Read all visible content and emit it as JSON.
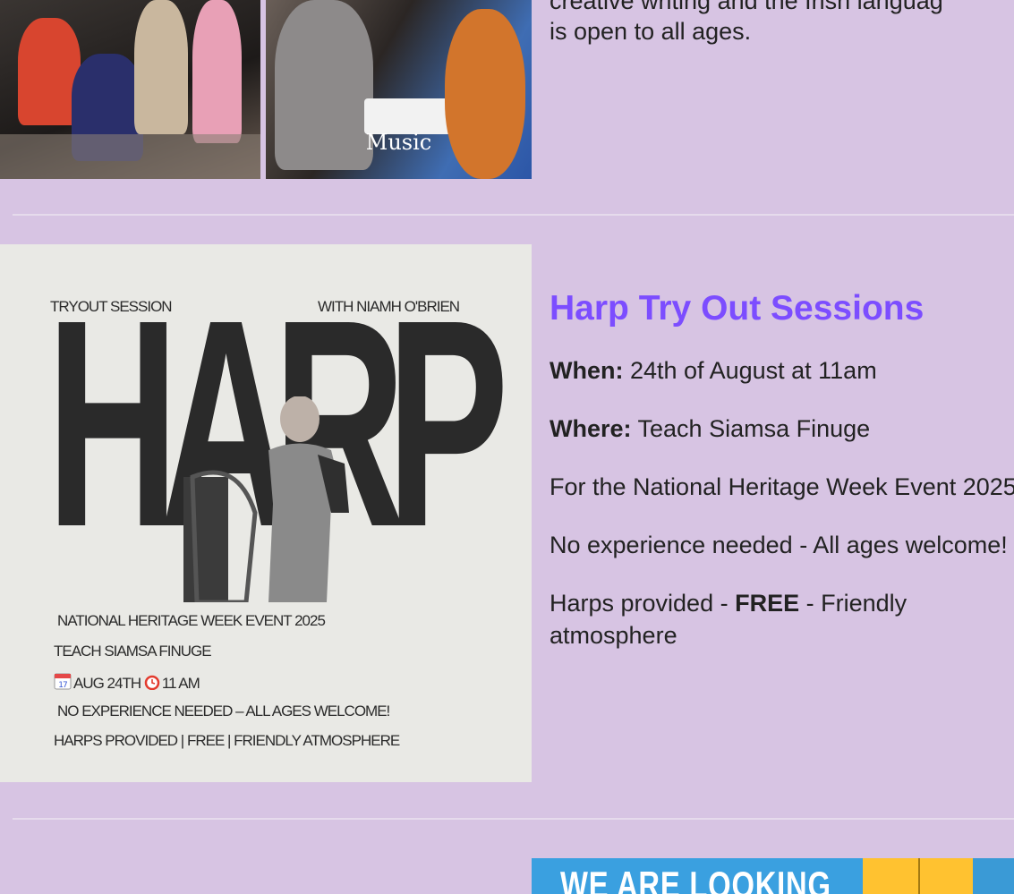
{
  "top": {
    "photo_right_caption": "Music",
    "intro_line1": "creative writing and the Irish languag",
    "intro_line2": "is open to all ages."
  },
  "poster": {
    "tryout": "TRYOUT SESSION",
    "with": "WITH NIAMH O'BRIEN",
    "big_word": "HARP",
    "line_event": "NATIONAL HERITAGE WEEK EVENT 2025",
    "line_venue": "TEACH SIAMSA FINUGE",
    "line_date": "AUG 24TH",
    "line_time": "11 AM",
    "line_experience": "NO EXPERIENCE NEEDED – ALL AGES WELCOME!",
    "line_harps": "HARPS PROVIDED | FREE | FRIENDLY ATMOSPHERE",
    "calendar_day": "17"
  },
  "harp_info": {
    "title": "Harp Try Out Sessions",
    "when_label": "When:",
    "when_value": " 24th of August at 11am",
    "where_label": "Where:",
    "where_value": " Teach Siamsa Finuge",
    "national": "For the National Heritage Week Event 2025",
    "experience": "No experience needed - All ages welcome!",
    "harps_pre": "Harps provided - ",
    "harps_free": "FREE",
    "harps_post": " - Friendly atmosphere"
  },
  "banner": {
    "title": "WE ARE LOOKING"
  },
  "colors": {
    "background": "#d7c4e3",
    "heading": "#7c4dff",
    "poster_bg": "#e9e9e5"
  }
}
